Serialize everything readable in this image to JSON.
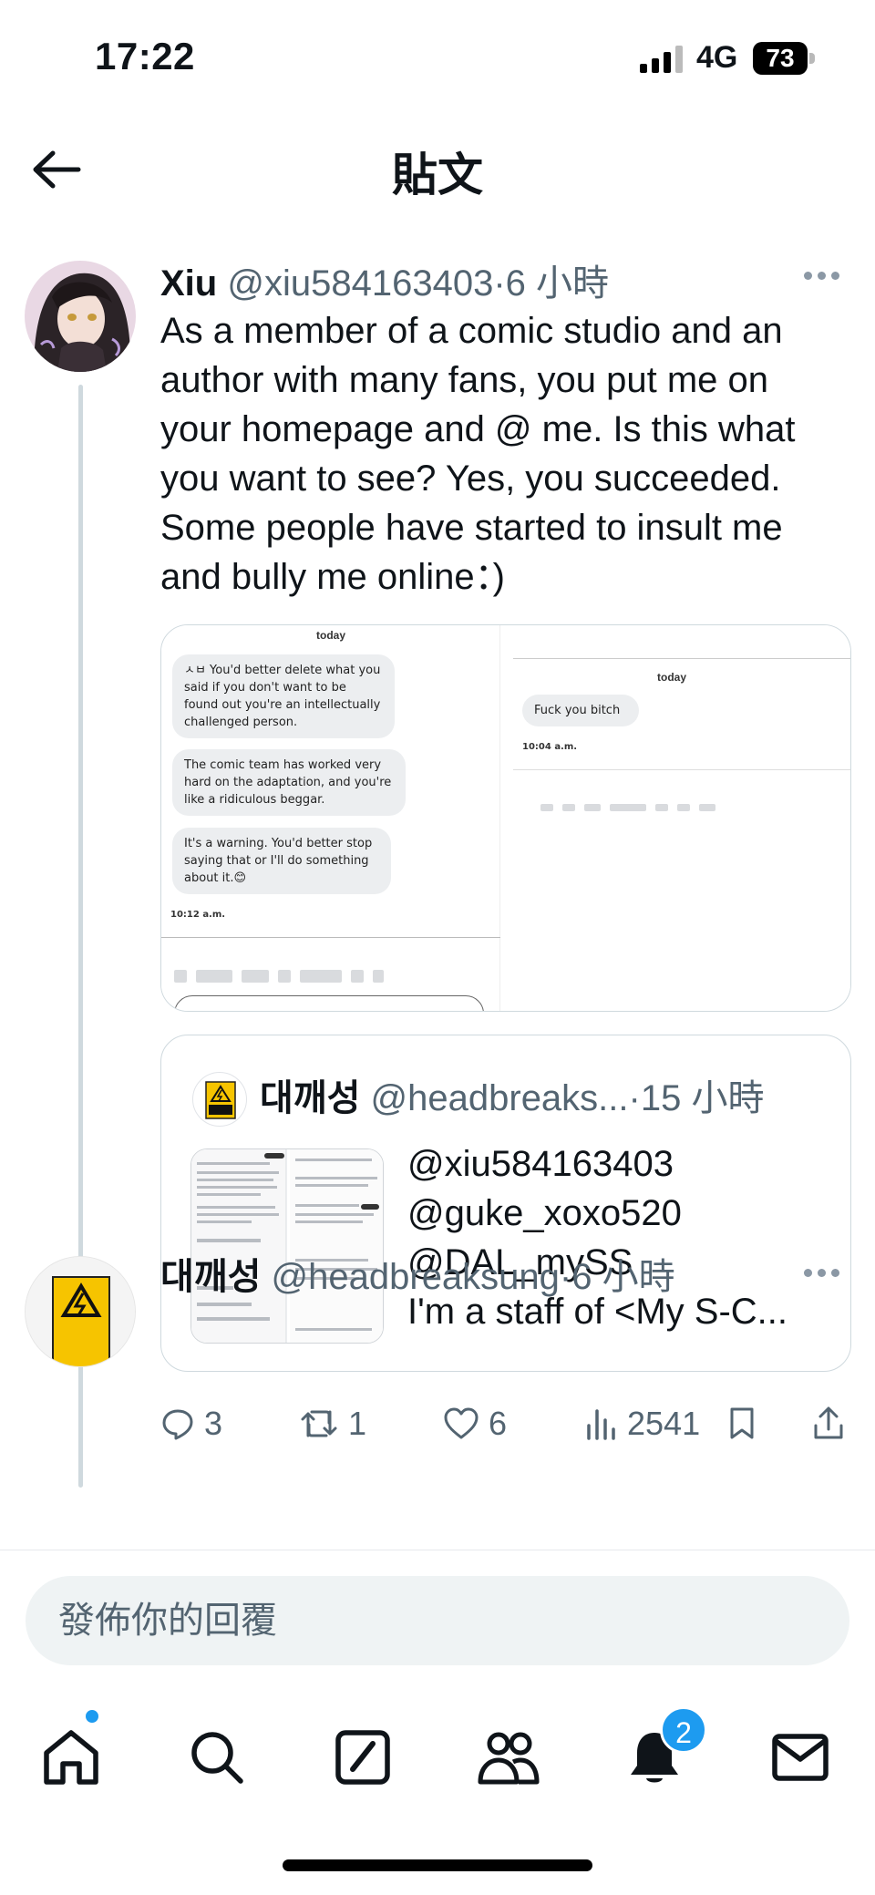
{
  "status": {
    "time": "17:22",
    "network": "4G",
    "battery": "73"
  },
  "header": {
    "title": "貼文"
  },
  "post": {
    "author": "Xiu",
    "handle": "@xiu584163403",
    "dot": "·",
    "time": "6 小時",
    "text_lines": [
      "As a member of a comic studio and an",
      "author with many fans, you put me on",
      "your homepage and @ me. Is this what",
      "you want to see? Yes, you succeeded.",
      "Some people have started to insult me",
      "and bully me online：)"
    ],
    "media": {
      "left": {
        "day": "today",
        "messages": [
          "ㅅㅂ You'd better delete what you said if you don't want to be found out you're an intellectually challenged person.",
          "The comic team has worked very hard on the adaptation, and you're like a ridiculous beggar.",
          "It's a warning. You'd better stop saying that or I'll do something about it.😊"
        ],
        "time": "10:12 a.m."
      },
      "right": {
        "day": "today",
        "messages": [
          "Fuck you bitch"
        ],
        "time": "10:04 a.m."
      }
    },
    "quote": {
      "name": "대깨성",
      "handle": "@headbreaks...",
      "dot": "·",
      "time": "15 小時",
      "lines": [
        "@xiu584163403",
        "@guke_xoxo520",
        "@DAL_mySS",
        "I'm a staff of <My S-C..."
      ]
    },
    "actions": {
      "replies": "3",
      "reposts": "1",
      "likes": "6",
      "views": "2541"
    }
  },
  "next_reply": {
    "name": "대깨성",
    "handle": "@headbreaksung",
    "dot": "·",
    "time": "6 小時"
  },
  "compose": {
    "placeholder": "發佈你的回覆"
  },
  "tabbar": {
    "items": [
      "home",
      "search",
      "compose",
      "communities",
      "notifications",
      "messages"
    ],
    "notification_count": "2"
  },
  "colors": {
    "accent": "#1d9bf0",
    "muted": "#536471",
    "text": "#0f1419"
  }
}
